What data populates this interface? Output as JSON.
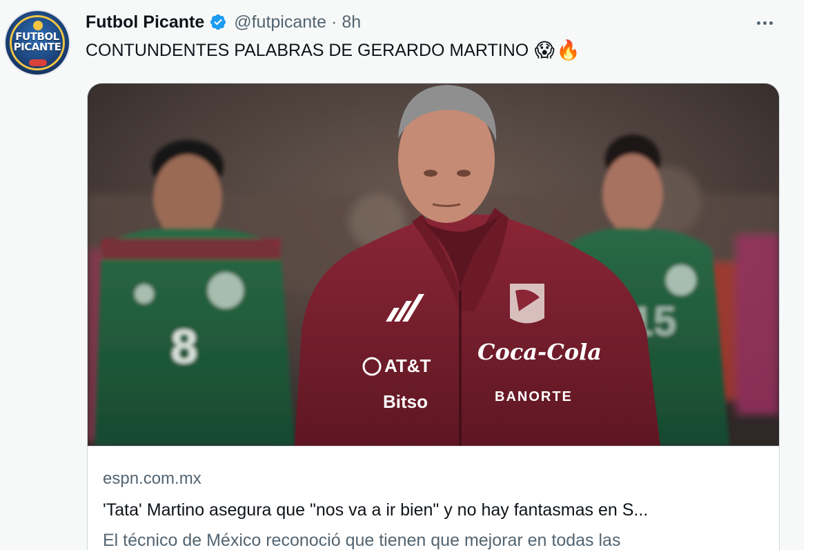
{
  "author": {
    "display_name": "Futbol Picante",
    "handle": "@futpicante",
    "separator": "·",
    "time": "8h",
    "avatar_text_line1": "FUTBOL",
    "avatar_text_line2": "PICANTE"
  },
  "tweet": {
    "text": "CONTUNDENTES PALABRAS DE GERARDO MARTINO",
    "emoji_1": "😱",
    "emoji_2": "🔥"
  },
  "card": {
    "domain": "espn.com.mx",
    "title": "'Tata' Martino asegura que \"nos va a ir bien\" y no hay fantasmas en S...",
    "description": "El técnico de México reconoció que tienen que mejorar en todas las",
    "image": {
      "jacket_sponsor_1": "AT&T",
      "jacket_sponsor_2": "Coca-Cola",
      "jacket_sponsor_3": "Bitso",
      "jacket_sponsor_4": "BANORTE",
      "player_number": "8"
    }
  },
  "icons": {
    "verified": "verified-badge-icon",
    "more": "more-options-icon"
  },
  "colors": {
    "verified_blue": "#1d9bf0",
    "text_primary": "#0f1419",
    "text_secondary": "#536471",
    "jacket_maroon": "#7a1f2e",
    "jersey_green": "#1f5a3a"
  }
}
